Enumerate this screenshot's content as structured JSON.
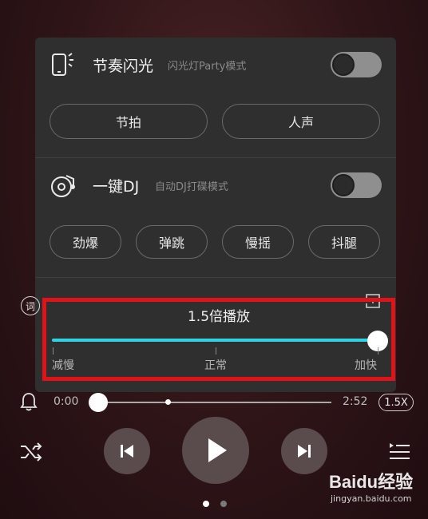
{
  "rhythm": {
    "title": "节奏闪光",
    "subtitle": "闪光灯Party模式",
    "toggle_on": false,
    "buttons": [
      "节拍",
      "人声"
    ]
  },
  "dj": {
    "title": "一键DJ",
    "subtitle": "自动DJ打碟模式",
    "toggle_on": false,
    "buttons": [
      "劲爆",
      "弹跳",
      "慢摇",
      "抖腿"
    ]
  },
  "speed": {
    "title": "1.5倍播放",
    "value_fraction": 1.0,
    "labels": {
      "slow": "减慢",
      "normal": "正常",
      "fast": "加快"
    }
  },
  "side": {
    "lyric_label": "词"
  },
  "player": {
    "current_time": "0:00",
    "total_time": "2:52",
    "progress_fraction": 0,
    "rate_badge": "1.5X",
    "page_indicator": {
      "count": 2,
      "active": 0
    }
  },
  "watermark": {
    "brand": "Baidu经验",
    "url": "jingyan.baidu.com"
  },
  "colors": {
    "accent": "#2fd3e6",
    "highlight_border": "#e0121a",
    "panel": "#2f2f2f"
  }
}
